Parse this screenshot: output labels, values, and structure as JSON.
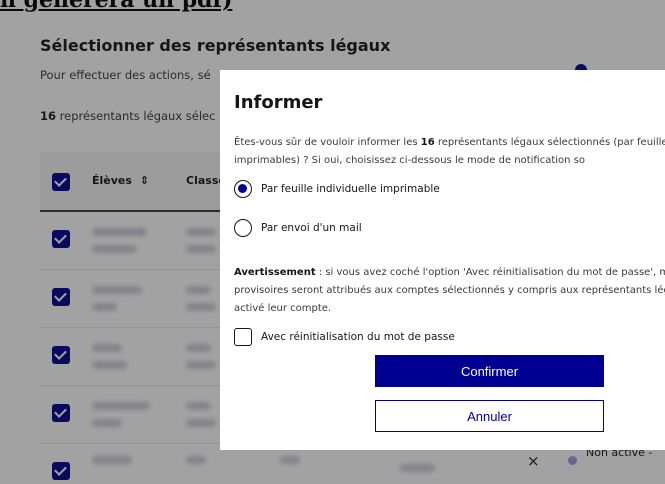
{
  "doc_heading": "n générera un pdf)",
  "background": {
    "title": "Sélectionner des représentants légaux",
    "subtitle": "Pour effectuer des actions, sé",
    "count_number": "16",
    "count_text": " représentants légaux sélec",
    "table": {
      "col_eleves": "Élèves",
      "col_classe": "Classe"
    },
    "last_row": {
      "remove_glyph": "×",
      "status": "Non activé -"
    }
  },
  "modal": {
    "title": "Informer",
    "intro_a": "Êtes-vous sûr de vouloir informer les ",
    "intro_count": "16",
    "intro_b": " représentants légaux sélectionnés (par feuilles individuelles imprimables) ? Si oui, choisissez ci-dessous le mode de notification so",
    "option_print": "Par feuille individuelle imprimable",
    "option_mail": "Par envoi d'un mail",
    "warning_label": "Avertissement",
    "warning_text": " : si vous avez coché l'option 'Avec réinitialisation du mot de passe', mots de passe provisoires seront attribués aux comptes sélectionnés y compris aux représentants légaux ayant déjà activé leur compte.",
    "checkbox_label": "Avec réinitialisation du mot de passe",
    "confirm_label": "Confirmer",
    "cancel_label": "Annuler"
  },
  "colors": {
    "primary": "#000091",
    "overlay": "rgba(22,22,22,0.40)",
    "text": "#161616"
  }
}
